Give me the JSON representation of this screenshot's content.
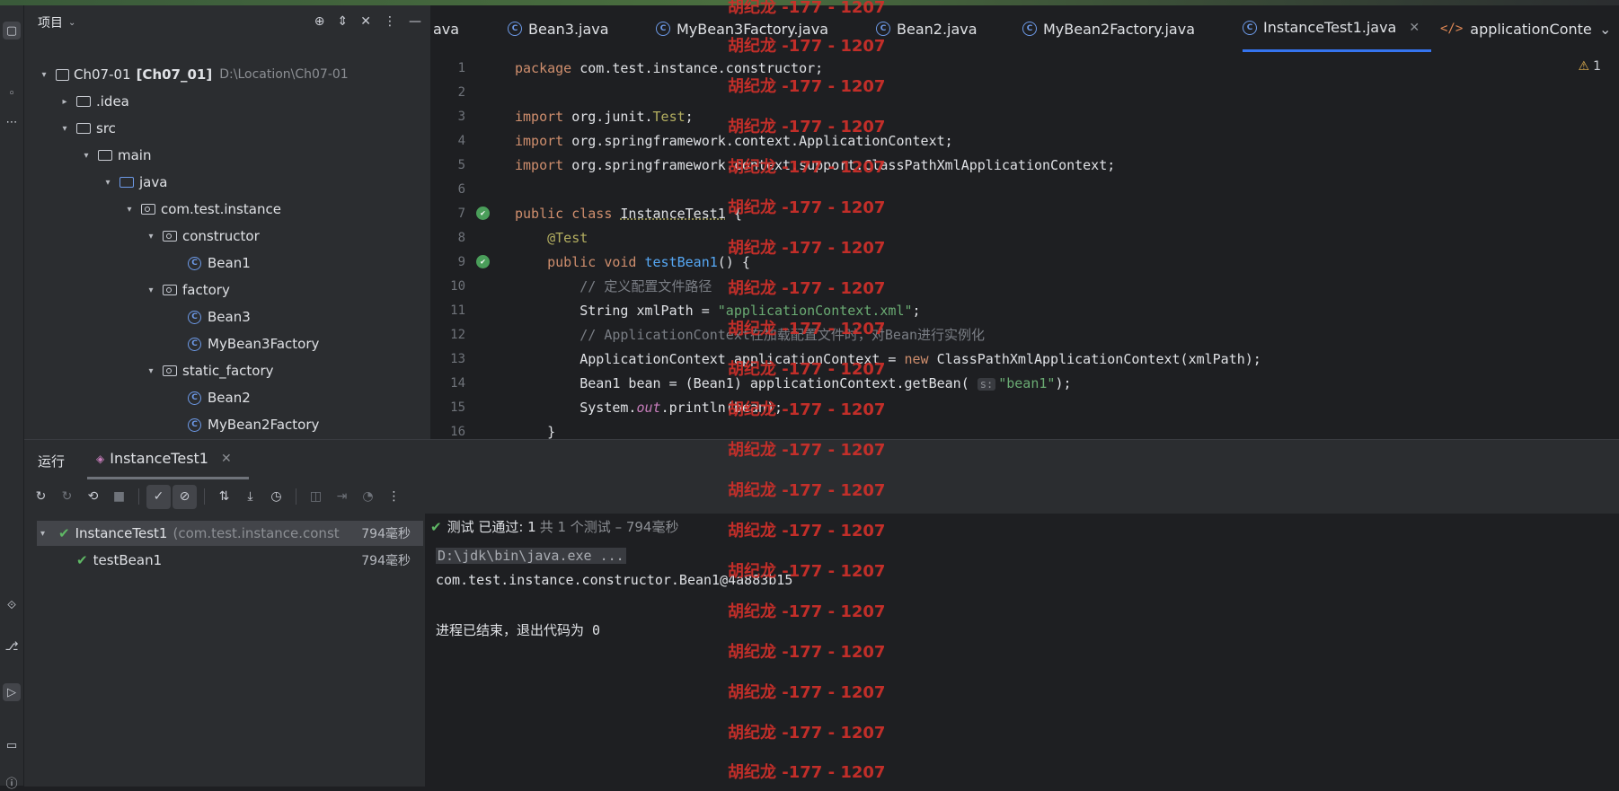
{
  "project": {
    "title": "项目",
    "tree": [
      {
        "label": "Ch07-01",
        "bold": "[Ch07_01]",
        "path": "D:\\Location\\Ch07-01"
      },
      {
        "label": ".idea"
      },
      {
        "label": "src"
      },
      {
        "label": "main"
      },
      {
        "label": "java"
      },
      {
        "label": "com.test.instance"
      },
      {
        "label": "constructor"
      },
      {
        "label": "Bean1"
      },
      {
        "label": "factory"
      },
      {
        "label": "Bean3"
      },
      {
        "label": "MyBean3Factory"
      },
      {
        "label": "static_factory"
      },
      {
        "label": "Bean2"
      },
      {
        "label": "MyBean2Factory"
      }
    ]
  },
  "tabs": [
    {
      "label": "ava"
    },
    {
      "label": "Bean3.java"
    },
    {
      "label": "MyBean3Factory.java"
    },
    {
      "label": "Bean2.java"
    },
    {
      "label": "MyBean2Factory.java"
    },
    {
      "label": "InstanceTest1.java"
    },
    {
      "label": "applicationConte"
    }
  ],
  "editor": {
    "warning_count": "1",
    "lines": [
      {
        "n": "1",
        "t": "package com.test.instance.constructor;"
      },
      {
        "n": "2",
        "t": ""
      },
      {
        "n": "3",
        "t": "import org.junit.Test;"
      },
      {
        "n": "4",
        "t": "import org.springframework.context.ApplicationContext;"
      },
      {
        "n": "5",
        "t": "import org.springframework.context.support.ClassPathXmlApplicationContext;"
      },
      {
        "n": "6",
        "t": ""
      },
      {
        "n": "7",
        "t": "public class InstanceTest1 {"
      },
      {
        "n": "8",
        "t": "    @Test"
      },
      {
        "n": "9",
        "t": "    public void testBean1() {"
      },
      {
        "n": "10",
        "t": "        // 定义配置文件路径"
      },
      {
        "n": "11",
        "t": "        String xmlPath = \"applicationContext.xml\";"
      },
      {
        "n": "12",
        "t": "        // ApplicationContext在加载配置文件时，对Bean进行实例化"
      },
      {
        "n": "13",
        "t": "        ApplicationContext applicationContext = new ClassPathXmlApplicationContext(xmlPath);"
      },
      {
        "n": "14",
        "t": "        Bean1 bean = (Bean1) applicationContext.getBean( s: \"bean1\");"
      },
      {
        "n": "15",
        "t": "        System.out.println(bean);"
      },
      {
        "n": "16",
        "t": "    }"
      }
    ],
    "param_hint": "s:"
  },
  "run": {
    "title": "运行",
    "tab": "InstanceTest1",
    "tests": [
      {
        "name": "InstanceTest1",
        "pkg": "(com.test.instance.const",
        "time": "794毫秒"
      },
      {
        "name": "testBean1",
        "pkg": "",
        "time": "794毫秒"
      }
    ],
    "status_passed": "测试 已通过: 1",
    "status_count": "共 1 个测试 – 794毫秒",
    "console": [
      "D:\\jdk\\bin\\java.exe ...",
      "com.test.instance.constructor.Bean1@4a883b15",
      "",
      "进程已结束，退出代码为 0"
    ]
  },
  "watermark": "胡纪龙 -177 - 1207"
}
